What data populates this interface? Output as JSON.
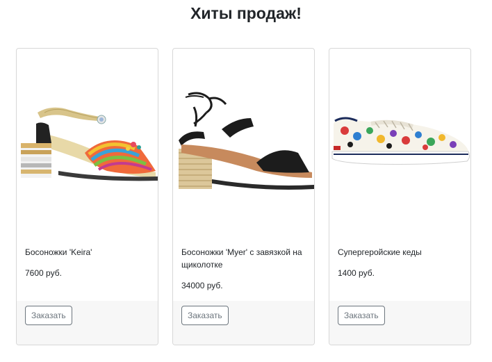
{
  "page": {
    "heading": "Хиты продаж!"
  },
  "products": [
    {
      "title": "Босоножки 'Keira'",
      "price": "7600 руб.",
      "button_label": "Заказать",
      "image_icon": "multicolor-block-heel-sandal"
    },
    {
      "title": "Босоножки 'Myer' с завязкой на щиколотке",
      "price": "34000 руб.",
      "button_label": "Заказать",
      "image_icon": "black-espadrille-heel-sandal"
    },
    {
      "title": "Супергеройские кеды",
      "price": "1400 руб.",
      "button_label": "Заказать",
      "image_icon": "superhero-print-sneaker"
    }
  ]
}
